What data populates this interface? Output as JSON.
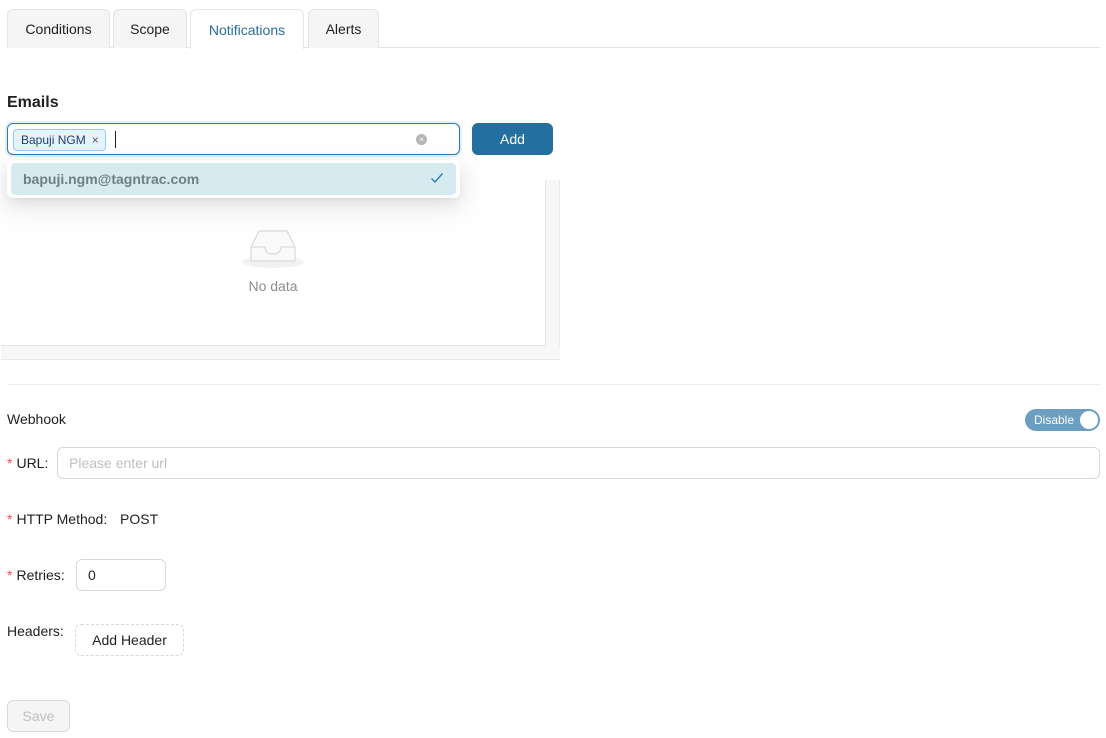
{
  "tabs": [
    {
      "label": "Conditions"
    },
    {
      "label": "Scope"
    },
    {
      "label": "Notifications",
      "active": true
    },
    {
      "label": "Alerts"
    }
  ],
  "emails": {
    "title": "Emails",
    "selected_tags": [
      "Bapuji NGM"
    ],
    "tag_remove_glyph": "×",
    "clear_glyph": "×",
    "add_label": "Add",
    "dropdown_options": [
      {
        "label": "bapuji.ngm@tagntrac.com",
        "selected": true
      }
    ],
    "empty_text": "No data"
  },
  "webhook": {
    "title": "Webhook",
    "toggle_label": "Disable",
    "url_label": "URL",
    "url_placeholder": "Please enter url",
    "url_value": "",
    "method_label": "HTTP Method",
    "method_value": "POST",
    "retries_label": "Retries",
    "retries_value": "0",
    "headers_label": "Headers",
    "add_header_label": "Add Header",
    "required_mark": "*",
    "label_colon": ":"
  },
  "save_label": "Save",
  "colors": {
    "accent": "#236fa0",
    "active_tab_text": "#2a6e9a",
    "option_highlight": "#d6ebef",
    "toggle_bg": "#6a9fc1",
    "required": "#ff4d4f"
  }
}
